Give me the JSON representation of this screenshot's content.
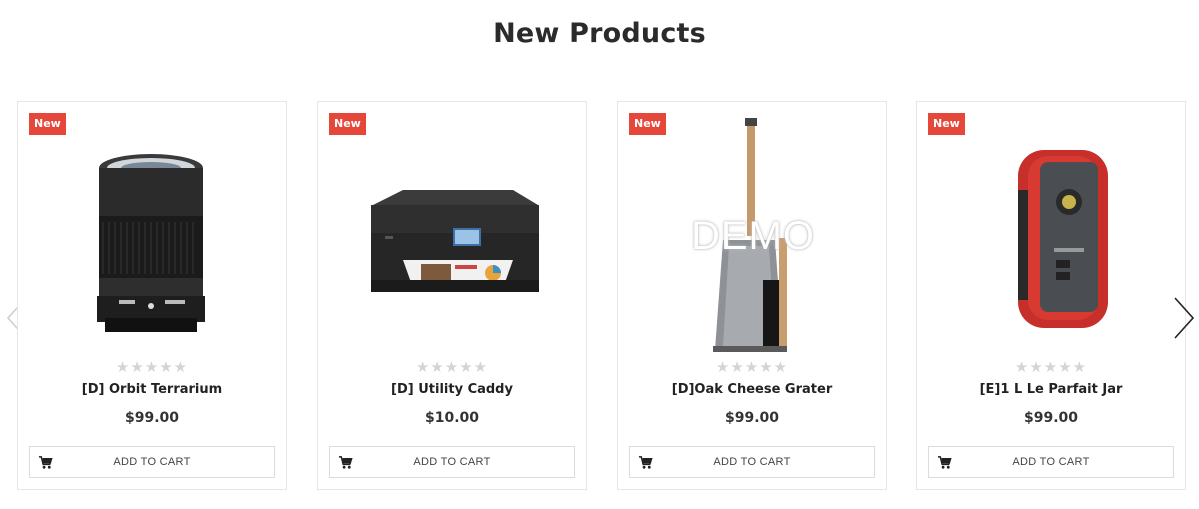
{
  "section": {
    "title": "New Products"
  },
  "carousel": {
    "prev_icon": "chevron-left-icon",
    "next_icon": "chevron-right-icon"
  },
  "colors": {
    "badge": "#e5473a",
    "star_empty": "#d4d4d4"
  },
  "products": [
    {
      "badge": "New",
      "name": "[D] Orbit Terrarium",
      "price": "$99.00",
      "rating": 0,
      "image_icon": "camera-lens-image",
      "cart_label": "ADD TO CART"
    },
    {
      "badge": "New",
      "name": "[D] Utility Caddy",
      "price": "$10.00",
      "rating": 0,
      "image_icon": "printer-image",
      "cart_label": "ADD TO CART"
    },
    {
      "badge": "New",
      "name": "[D]Oak Cheese Grater",
      "price": "$99.00",
      "rating": 0,
      "image_icon": "dustpan-brush-image",
      "watermark": "DEMO",
      "cart_label": "ADD TO CART"
    },
    {
      "badge": "New",
      "name": "[E]1 L Le Parfait Jar",
      "price": "$99.00",
      "rating": 0,
      "image_icon": "red-radio-image",
      "cart_label": "ADD TO CART"
    }
  ]
}
